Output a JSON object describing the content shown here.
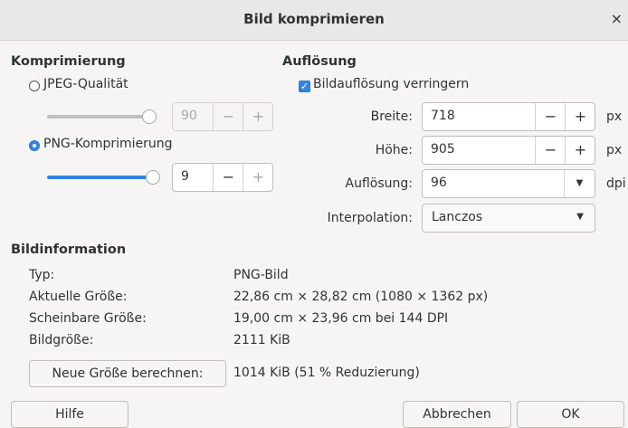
{
  "window": {
    "title": "Bild komprimieren",
    "close_glyph": "×"
  },
  "compression": {
    "heading": "Komprimierung",
    "jpeg_label": "JPEG-Qualität",
    "jpeg_selected": false,
    "jpeg_quality_value": "90",
    "jpeg_slider_level": 1.0,
    "png_label": "PNG-Komprimierung",
    "png_selected": true,
    "png_compression_value": "9",
    "png_slider_level": 1.0,
    "minus": "−",
    "plus": "+"
  },
  "resolution": {
    "heading": "Auflösung",
    "reduce_label": "Bildauflösung verringern",
    "reduce_checked": true,
    "width_label": "Breite:",
    "width_value": "718",
    "width_unit": "px",
    "height_label": "Höhe:",
    "height_value": "905",
    "height_unit": "px",
    "dpi_label": "Auflösung:",
    "dpi_value": "96",
    "dpi_unit": "dpi",
    "interp_label": "Interpolation:",
    "interp_value": "Lanczos"
  },
  "info": {
    "heading": "Bildinformation",
    "type_label": "Typ:",
    "type_value": "PNG-Bild",
    "actual_label": "Aktuelle Größe:",
    "actual_value": "22,86 cm × 28,82 cm (1080 × 1362 px)",
    "apparent_label": "Scheinbare Größe:",
    "apparent_value": "19,00 cm × 23,96 cm bei 144 DPI",
    "filesize_label": "Bildgröße:",
    "filesize_value": "2111 KiB",
    "recalc_button": "Neue Größe berechnen:",
    "new_size_value": "1014 KiB (51 % Reduzierung)"
  },
  "footer": {
    "help": "Hilfe",
    "cancel": "Abbrechen",
    "ok": "OK"
  },
  "icons": {
    "check": "checkmark-icon",
    "dropdown": "chevron-down-icon"
  },
  "colors": {
    "accent": "#3584e4",
    "background": "#f6f5f4",
    "titlebar": "#e8e8e7"
  }
}
